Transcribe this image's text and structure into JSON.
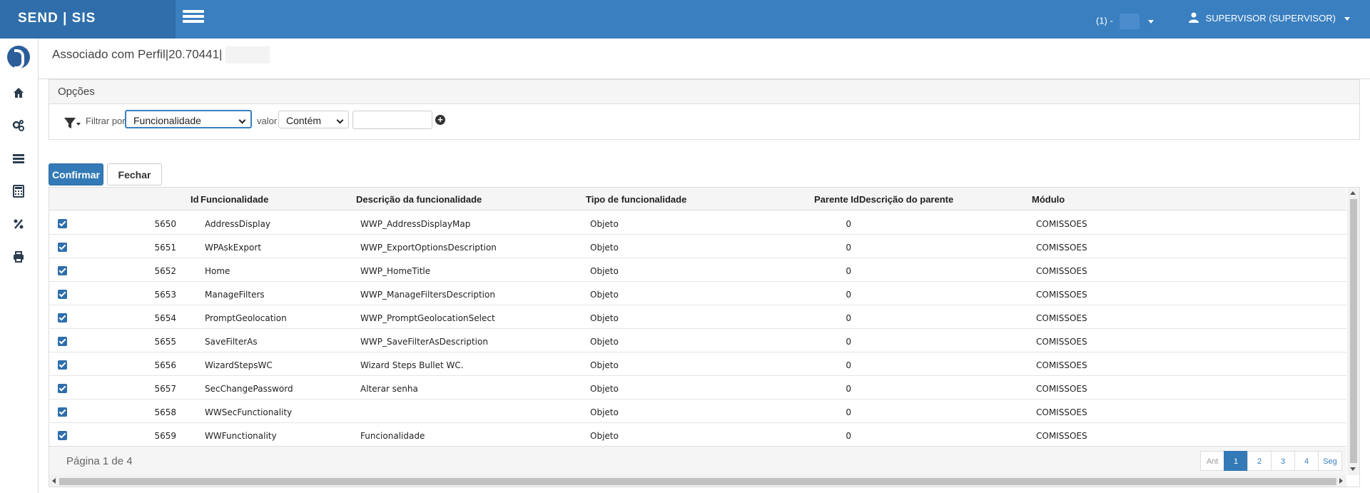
{
  "header": {
    "brand": "SEND | SIS",
    "company": "(1) -",
    "user": "SUPERVISOR (SUPERVISOR)"
  },
  "sidebar": {
    "icons": [
      "home-icon",
      "gears-icon",
      "list-icon",
      "calculator-icon",
      "percent-icon",
      "print-icon"
    ]
  },
  "page": {
    "title": "Associado com Perfil|20.70441|"
  },
  "options": {
    "heading": "Opções",
    "filter_label": "Filtrar por",
    "filter_value": "Funcionalidade",
    "value_label": "valor",
    "operator_value": "Contém",
    "search_value": ""
  },
  "actions": {
    "confirm": "Confirmar",
    "close": "Fechar"
  },
  "table": {
    "headers": {
      "id": "Id",
      "func": "Funcionalidade",
      "desc": "Descrição da funcionalidade",
      "type": "Tipo de funcionalidade",
      "parent_id": "Parente Id",
      "parent_desc": "Descrição do parente",
      "module": "Módulo"
    },
    "rows": [
      {
        "id": "5650",
        "func": "AddressDisplay",
        "desc": "WWP_AddressDisplayMap",
        "type": "Objeto",
        "parent_id": "0",
        "parent_desc": "",
        "module": "COMISSOES",
        "checked": true
      },
      {
        "id": "5651",
        "func": "WPAskExport",
        "desc": "WWP_ExportOptionsDescription",
        "type": "Objeto",
        "parent_id": "0",
        "parent_desc": "",
        "module": "COMISSOES",
        "checked": true
      },
      {
        "id": "5652",
        "func": "Home",
        "desc": "WWP_HomeTitle",
        "type": "Objeto",
        "parent_id": "0",
        "parent_desc": "",
        "module": "COMISSOES",
        "checked": true
      },
      {
        "id": "5653",
        "func": "ManageFilters",
        "desc": "WWP_ManageFiltersDescription",
        "type": "Objeto",
        "parent_id": "0",
        "parent_desc": "",
        "module": "COMISSOES",
        "checked": true
      },
      {
        "id": "5654",
        "func": "PromptGeolocation",
        "desc": "WWP_PromptGeolocationSelect",
        "type": "Objeto",
        "parent_id": "0",
        "parent_desc": "",
        "module": "COMISSOES",
        "checked": true
      },
      {
        "id": "5655",
        "func": "SaveFilterAs",
        "desc": "WWP_SaveFilterAsDescription",
        "type": "Objeto",
        "parent_id": "0",
        "parent_desc": "",
        "module": "COMISSOES",
        "checked": true
      },
      {
        "id": "5656",
        "func": "WizardStepsWC",
        "desc": "Wizard Steps Bullet WC.",
        "type": "Objeto",
        "parent_id": "0",
        "parent_desc": "",
        "module": "COMISSOES",
        "checked": true
      },
      {
        "id": "5657",
        "func": "SecChangePassword",
        "desc": "Alterar senha",
        "type": "Objeto",
        "parent_id": "0",
        "parent_desc": "",
        "module": "COMISSOES",
        "checked": true
      },
      {
        "id": "5658",
        "func": "WWSecFunctionality",
        "desc": "",
        "type": "Objeto",
        "parent_id": "0",
        "parent_desc": "",
        "module": "COMISSOES",
        "checked": true
      },
      {
        "id": "5659",
        "func": "WWFunctionality",
        "desc": "Funcionalidade",
        "type": "Objeto",
        "parent_id": "0",
        "parent_desc": "",
        "module": "COMISSOES",
        "checked": true
      }
    ]
  },
  "footer": {
    "page_info": "Página 1 de 4",
    "prev": "Ant",
    "pages": [
      "1",
      "2",
      "3",
      "4"
    ],
    "next": "Seg",
    "current_page": "1"
  },
  "colors": {
    "header_bg": "#3a7fc0",
    "brand_bg": "#2f6eab",
    "primary": "#337ab7"
  }
}
